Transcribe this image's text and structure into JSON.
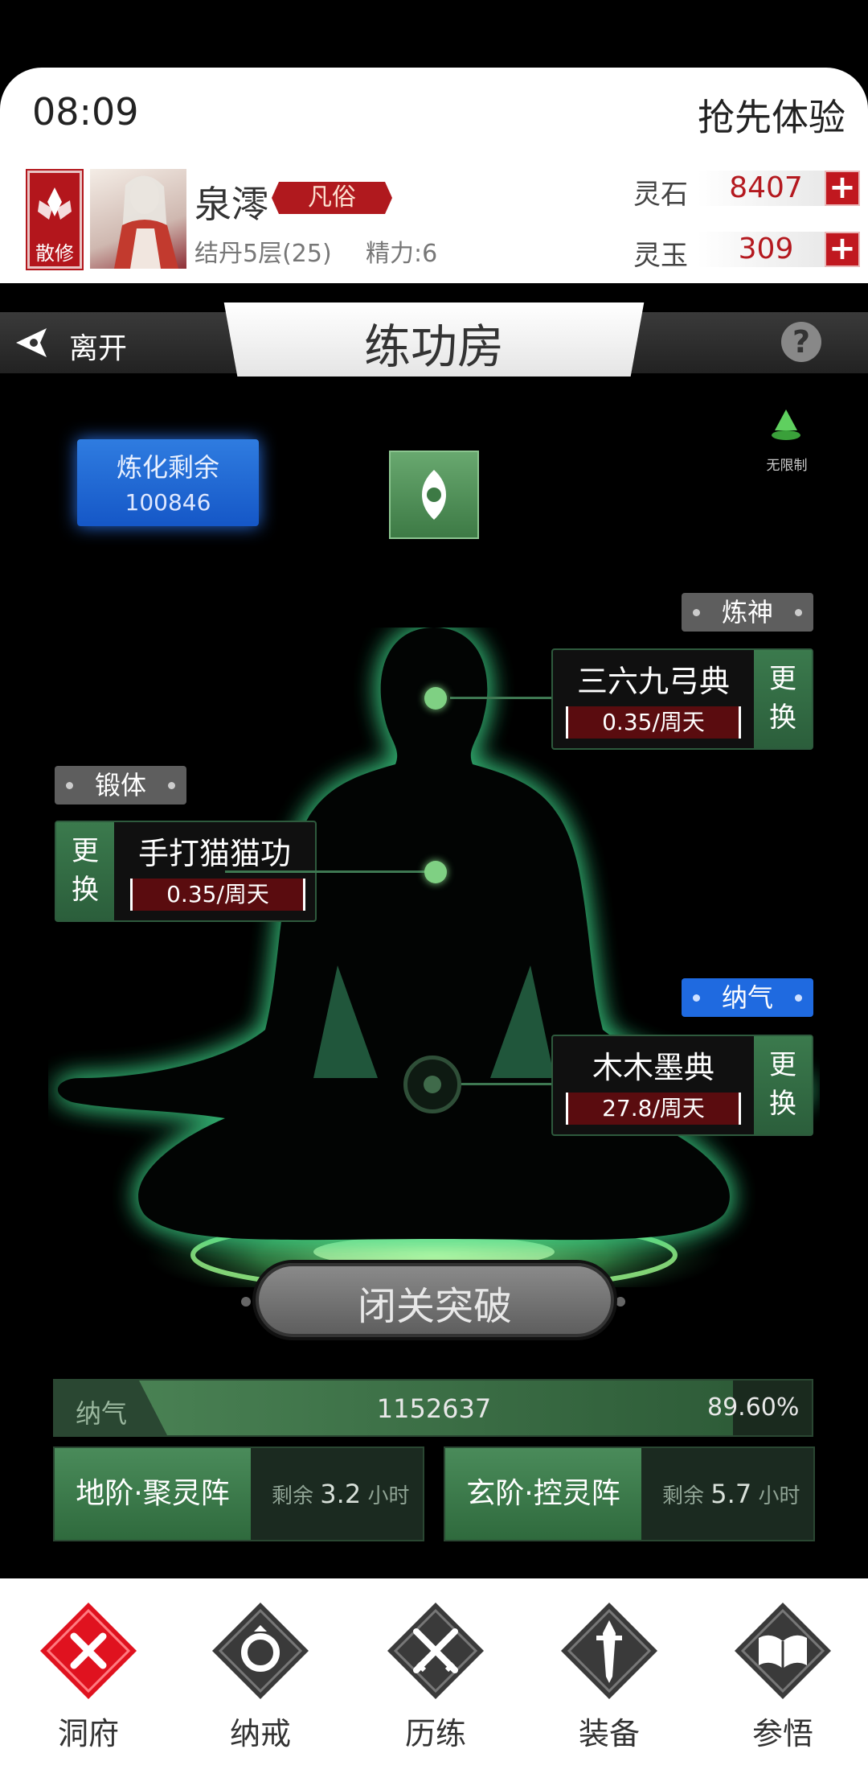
{
  "status": {
    "time": "08:09",
    "early_access": "抢先体验"
  },
  "player": {
    "sect_badge": "散修",
    "name": "泉澪",
    "rank": "凡俗",
    "level": "结丹5层(25)",
    "energy": "精力:6"
  },
  "resources": [
    {
      "label": "灵石",
      "value": "8407"
    },
    {
      "label": "灵玉",
      "value": "309"
    }
  ],
  "titlebar": {
    "leave": "离开",
    "title": "练功房",
    "help": "?"
  },
  "refine": {
    "label": "炼化剩余",
    "value": "100846"
  },
  "unlimited": {
    "label": "无限制"
  },
  "skills": {
    "spirit": {
      "tag": "炼神",
      "name": "三六九弓典",
      "rate": "0.35/周天",
      "swap": "更换"
    },
    "body": {
      "tag": "锻体",
      "name": "手打猫猫功",
      "rate": "0.35/周天",
      "swap": "更换"
    },
    "qi": {
      "tag": "纳气",
      "name": "木木墨典",
      "rate": "27.8/周天",
      "swap": "更换"
    }
  },
  "breakthrough": {
    "label": "闭关突破"
  },
  "qi_bar": {
    "label": "纳气",
    "value": "1152637",
    "percent": "89.60%",
    "fraction": 0.896
  },
  "arrays": [
    {
      "name": "地阶·聚灵阵",
      "remain_prefix": "剩余",
      "remain_value": "3.2",
      "remain_unit": "小时"
    },
    {
      "name": "玄阶·控灵阵",
      "remain_prefix": "剩余",
      "remain_value": "5.7",
      "remain_unit": "小时"
    }
  ],
  "nav": [
    {
      "label": "洞府",
      "icon": "cave-icon",
      "active": true
    },
    {
      "label": "纳戒",
      "icon": "ring-icon",
      "active": false
    },
    {
      "label": "历练",
      "icon": "crossed-swords-icon",
      "active": false
    },
    {
      "label": "装备",
      "icon": "sword-icon",
      "active": false
    },
    {
      "label": "参悟",
      "icon": "book-icon",
      "active": false
    }
  ],
  "colors": {
    "accent_red": "#c0181f",
    "accent_green": "#3d7a45",
    "accent_blue": "#1f6ae0"
  }
}
